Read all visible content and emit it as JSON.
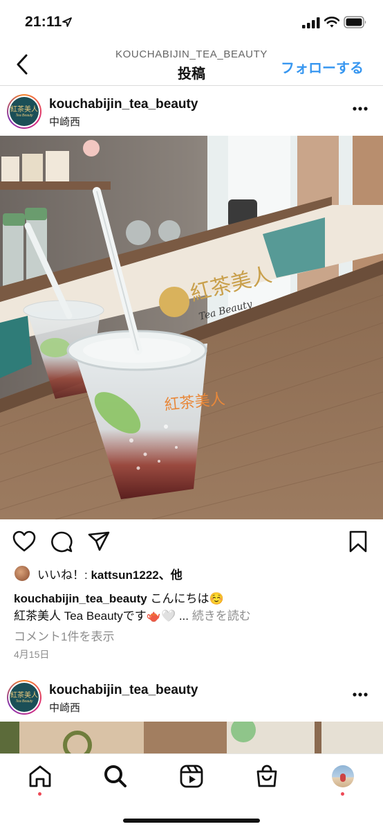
{
  "status_bar": {
    "time": "21:11",
    "icons": [
      "location-arrow-icon",
      "signal-icon",
      "wifi-icon",
      "battery-icon"
    ]
  },
  "nav": {
    "subtitle": "KOUCHABIJIN_TEA_BEAUTY",
    "title": "投稿",
    "follow_label": "フォローする",
    "accent": "#3897f0",
    "icons": [
      "back-chevron-icon"
    ]
  },
  "post": {
    "username": "kouchabijin_tea_beauty",
    "location": "中崎西",
    "avatar_text": "紅茶美人",
    "avatar_subtext": "Tea Beauty",
    "image_label": "紅茶美人",
    "image_logo": "Tea Beauty",
    "likes_prefix": "いいね！: ",
    "likes_user": "kattsun1222",
    "likes_suffix": "、他",
    "caption_user": "kouchabijin_tea_beauty",
    "caption_text": " こんにちは☺️",
    "caption_line2": "紅茶美人 Tea Beautyです🫖🤍 ... ",
    "more_label": "続きを読む",
    "view_comments": "コメント1件を表示",
    "date": "4月15日",
    "icons": [
      "heart-icon",
      "comment-icon",
      "share-icon",
      "bookmark-icon",
      "more-dots-icon"
    ]
  },
  "post2": {
    "username": "kouchabijin_tea_beauty",
    "location": "中崎西",
    "avatar_text": "紅茶美人",
    "avatar_subtext": "Tea Beauty"
  },
  "tabbar": {
    "tabs": [
      "home-icon",
      "search-icon",
      "reels-icon",
      "shop-icon",
      "profile-avatar"
    ],
    "notification_color": "#ed4956"
  }
}
